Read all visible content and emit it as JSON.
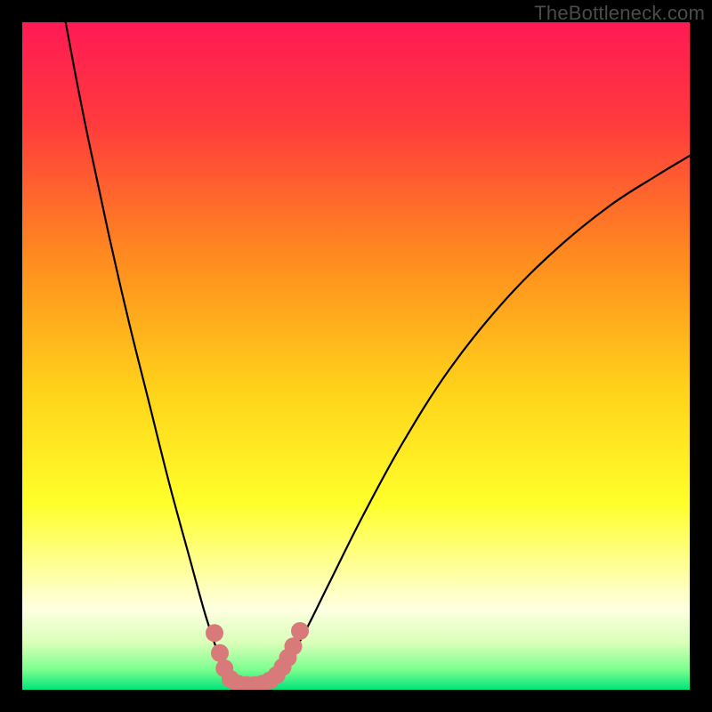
{
  "watermark": "TheBottleneck.com",
  "chart_data": {
    "type": "line",
    "title": "",
    "xlabel": "",
    "ylabel": "",
    "xlim": [
      0,
      100
    ],
    "ylim": [
      0,
      100
    ],
    "grid": false,
    "legend": false,
    "background_gradient": {
      "stops": [
        {
          "offset": 0.0,
          "color": "#ff1a54"
        },
        {
          "offset": 0.15,
          "color": "#ff3a3d"
        },
        {
          "offset": 0.35,
          "color": "#ff8a1f"
        },
        {
          "offset": 0.55,
          "color": "#ffd21a"
        },
        {
          "offset": 0.72,
          "color": "#ffff2a"
        },
        {
          "offset": 0.83,
          "color": "#ffffa8"
        },
        {
          "offset": 0.88,
          "color": "#fdffe0"
        },
        {
          "offset": 0.93,
          "color": "#d9ffb8"
        },
        {
          "offset": 0.97,
          "color": "#7bff8e"
        },
        {
          "offset": 1.0,
          "color": "#00e47a"
        }
      ]
    },
    "series": [
      {
        "name": "bottleneck-curve",
        "points": [
          {
            "x": 6.5,
            "y": 100.0
          },
          {
            "x": 8.0,
            "y": 92.0
          },
          {
            "x": 10.0,
            "y": 82.0
          },
          {
            "x": 13.0,
            "y": 68.0
          },
          {
            "x": 16.0,
            "y": 55.0
          },
          {
            "x": 19.0,
            "y": 43.0
          },
          {
            "x": 22.0,
            "y": 31.0
          },
          {
            "x": 25.0,
            "y": 20.0
          },
          {
            "x": 27.5,
            "y": 11.0
          },
          {
            "x": 29.5,
            "y": 5.0
          },
          {
            "x": 31.0,
            "y": 1.5
          },
          {
            "x": 33.0,
            "y": 0.5
          },
          {
            "x": 35.0,
            "y": 0.5
          },
          {
            "x": 37.0,
            "y": 1.0
          },
          {
            "x": 39.0,
            "y": 3.0
          },
          {
            "x": 42.0,
            "y": 8.0
          },
          {
            "x": 46.0,
            "y": 16.0
          },
          {
            "x": 51.0,
            "y": 26.0
          },
          {
            "x": 57.0,
            "y": 37.0
          },
          {
            "x": 64.0,
            "y": 48.0
          },
          {
            "x": 72.0,
            "y": 58.0
          },
          {
            "x": 80.0,
            "y": 66.0
          },
          {
            "x": 88.0,
            "y": 72.5
          },
          {
            "x": 95.0,
            "y": 77.0
          },
          {
            "x": 100.0,
            "y": 80.0
          }
        ]
      }
    ],
    "markers": {
      "name": "highlight-dots",
      "color": "#d97a7a",
      "radius": 10,
      "points": [
        {
          "x": 28.8,
          "y": 8.5
        },
        {
          "x": 29.6,
          "y": 5.5
        },
        {
          "x": 30.3,
          "y": 3.2
        },
        {
          "x": 31.2,
          "y": 1.6
        },
        {
          "x": 32.3,
          "y": 0.9
        },
        {
          "x": 33.6,
          "y": 0.7
        },
        {
          "x": 34.8,
          "y": 0.7
        },
        {
          "x": 36.0,
          "y": 0.9
        },
        {
          "x": 37.1,
          "y": 1.4
        },
        {
          "x": 38.1,
          "y": 2.2
        },
        {
          "x": 39.0,
          "y": 3.4
        },
        {
          "x": 39.8,
          "y": 4.8
        },
        {
          "x": 40.6,
          "y": 6.5
        },
        {
          "x": 41.6,
          "y": 8.8
        }
      ]
    }
  }
}
